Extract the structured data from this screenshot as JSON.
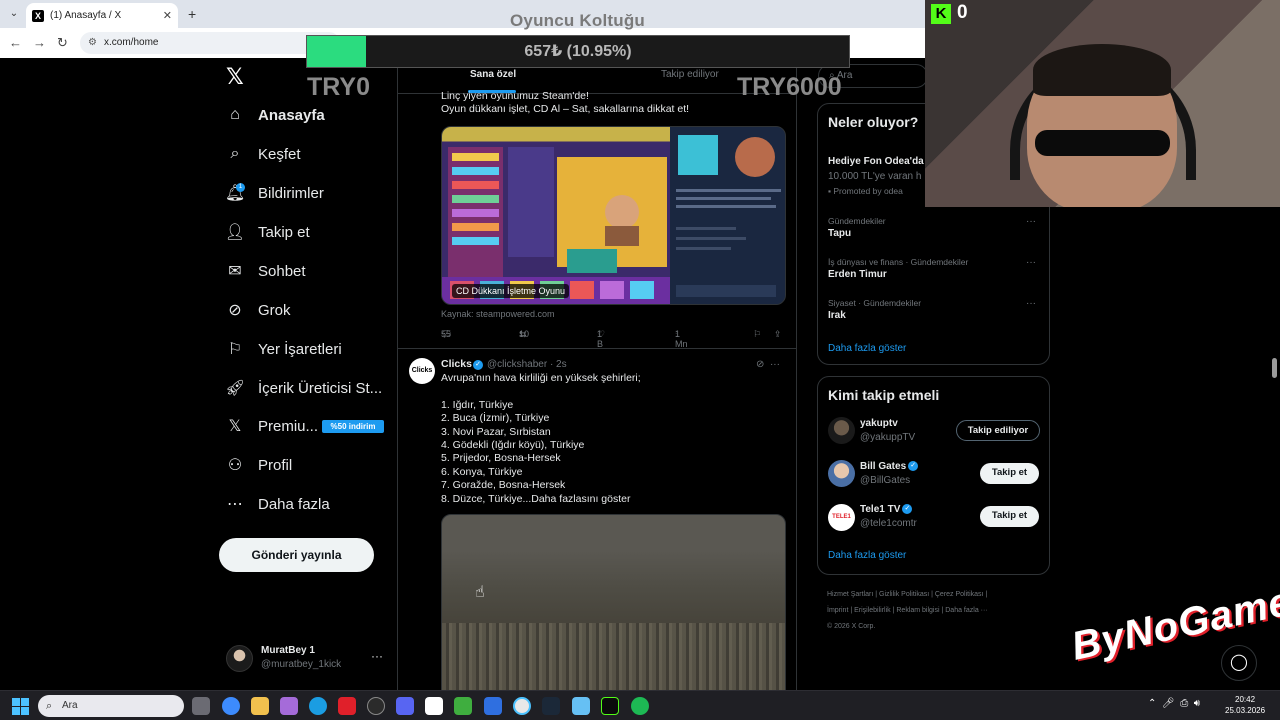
{
  "browser": {
    "tab_title": "(1) Anasayfa / X",
    "url": "x.com/home",
    "new_tab": "+",
    "tab_close": "✕"
  },
  "overlay": {
    "title": "Oyuncu Koltuğu",
    "progress_text": "657₺ (10.95%)",
    "progress_fraction": 0.1095,
    "left_label": "TRY0",
    "right_label": "TRY6000",
    "kick_count": "0"
  },
  "sidebar": {
    "items": [
      {
        "label": "Anasayfa",
        "icon": "home-icon"
      },
      {
        "label": "Keşfet",
        "icon": "search-icon"
      },
      {
        "label": "Bildirimler",
        "icon": "bell-icon"
      },
      {
        "label": "Takip et",
        "icon": "person-add-icon"
      },
      {
        "label": "Sohbet",
        "icon": "mail-icon"
      },
      {
        "label": "Grok",
        "icon": "grok-icon"
      },
      {
        "label": "Yer İşaretleri",
        "icon": "bookmark-icon"
      },
      {
        "label": "İçerik Üreticisi St...",
        "icon": "rocket-icon"
      },
      {
        "label": "Premiu...",
        "icon": "x-icon"
      },
      {
        "label": "Profil",
        "icon": "person-icon"
      },
      {
        "label": "Daha fazla",
        "icon": "more-circle-icon"
      }
    ],
    "premium_badge": "%50 indirim",
    "notif_count": "1",
    "post_button": "Gönderi yayınla",
    "profile_name": "MuratBey 1",
    "profile_handle": "@muratbey_1kick",
    "profile_more": "···"
  },
  "timeline": {
    "tab_for_you": "Sana özel",
    "tab_following": "Takip ediliyor",
    "tweet1_lines": [
      "Linç yiyen oyunumuz Steam'de!",
      "Oyun dükkanı işlet, CD Al – Sat, sakallarına dikkat et!"
    ],
    "tweet1_card_caption": "CD Dükkanı İşletme Oyunu",
    "tweet1_source": "Kaynak: steampowered.com",
    "tweet1_replies": "55",
    "tweet1_retweets": "10",
    "tweet1_likes": "1 B",
    "tweet1_views": "1 Mn",
    "tweet2_name": "Clicks",
    "tweet2_avatar": "Clicks",
    "tweet2_handle": "@clickshaber · 2s",
    "tweet2_lines": [
      "Avrupa'nın hava kirliliği en yüksek şehirleri;",
      "",
      "1. Iğdır, Türkiye",
      "2. Buca (İzmir), Türkiye",
      "3. Novi Pazar, Sırbistan",
      "4. Gödekli (Iğdır köyü), Türkiye",
      "5. Prijedor, Bosna-Hersek",
      "6. Konya, Türkiye",
      "7. Goražde, Bosna-Hersek",
      "8. Düzce, Türkiye...Daha fazlasını göster"
    ]
  },
  "right": {
    "search_placeholder": "Ara",
    "trends_title": "Neler oluyor?",
    "promo_title": "Hediye Fon Odea'da",
    "promo_desc": "10.000 TL'ye varan h",
    "promo_by": "Promoted by odea",
    "trends": [
      {
        "category": "Gündemdekiler",
        "name": "Tapu"
      },
      {
        "category": "İş dünyası ve finans · Gündemdekiler",
        "name": "Erden Timur"
      },
      {
        "category": "Siyaset · Gündemdekiler",
        "name": "Irak"
      }
    ],
    "trends_show_more": "Daha fazla göster",
    "wtf_title": "Kimi takip etmeli",
    "wtf": [
      {
        "name": "yakuptv",
        "handle": "@yakuppTV",
        "button": "Takip ediliyor",
        "verified": false
      },
      {
        "name": "Bill Gates",
        "handle": "@BillGates",
        "button": "Takip et",
        "verified": true
      },
      {
        "name": "Tele1 TV",
        "handle": "@tele1comtr",
        "button": "Takip et",
        "verified": true
      }
    ],
    "wtf_show_more": "Daha fazla göster",
    "footer_line1": "Hizmet Şartları  |  Gizlilik Politikası  |  Çerez Politikası  |",
    "footer_line2": "İmprint  |  Erişilebilirlik  |  Reklam bilgisi  |  Daha fazla ···",
    "footer_line3": "© 2026 X Corp."
  },
  "watermark": "ByNoGame",
  "taskbar": {
    "search": "Ara",
    "time": "20:42",
    "date": "25.03.2026"
  },
  "colors": {
    "accent": "#1d9bf0",
    "progress": "#2bdc7f",
    "kick": "#53fc18"
  }
}
